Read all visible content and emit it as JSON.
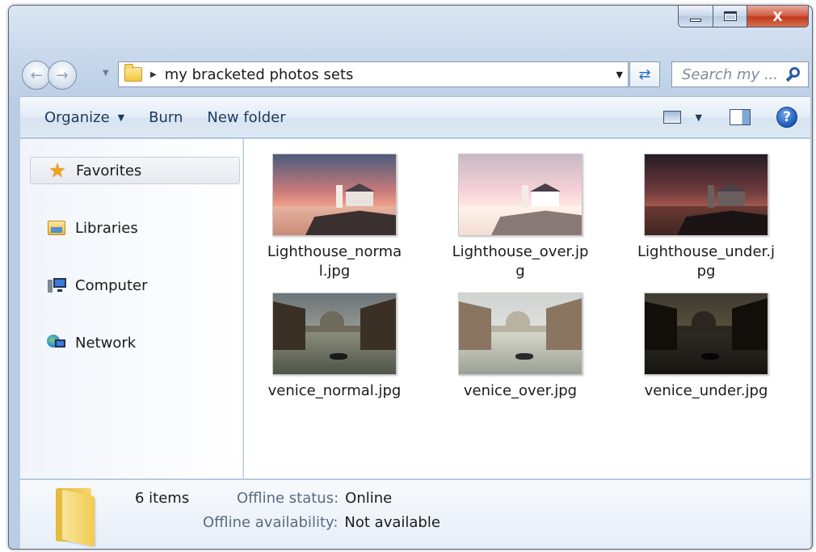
{
  "window": {
    "caption": {
      "minimize": "—",
      "maximize": "",
      "close": "X"
    }
  },
  "address": {
    "crumb": "my bracketed photos sets",
    "search_placeholder": "Search my ..."
  },
  "toolbar": {
    "organize": "Organize",
    "burn": "Burn",
    "new_folder": "New folder",
    "help": "?"
  },
  "sidebar": {
    "items": [
      {
        "label": "Favorites",
        "icon": "star-icon"
      },
      {
        "label": "Libraries",
        "icon": "libraries-icon"
      },
      {
        "label": "Computer",
        "icon": "computer-icon"
      },
      {
        "label": "Network",
        "icon": "network-icon"
      }
    ]
  },
  "files": [
    {
      "name": "Lighthouse_normal.jpg"
    },
    {
      "name": "Lighthouse_over.jpg"
    },
    {
      "name": "Lighthouse_under.jpg"
    },
    {
      "name": "venice_normal.jpg"
    },
    {
      "name": "venice_over.jpg"
    },
    {
      "name": "venice_under.jpg"
    }
  ],
  "details": {
    "count": "6 items",
    "offline_status_label": "Offline status:",
    "offline_status_value": "Online",
    "offline_availability_label": "Offline availability:",
    "offline_availability_value": "Not available"
  }
}
